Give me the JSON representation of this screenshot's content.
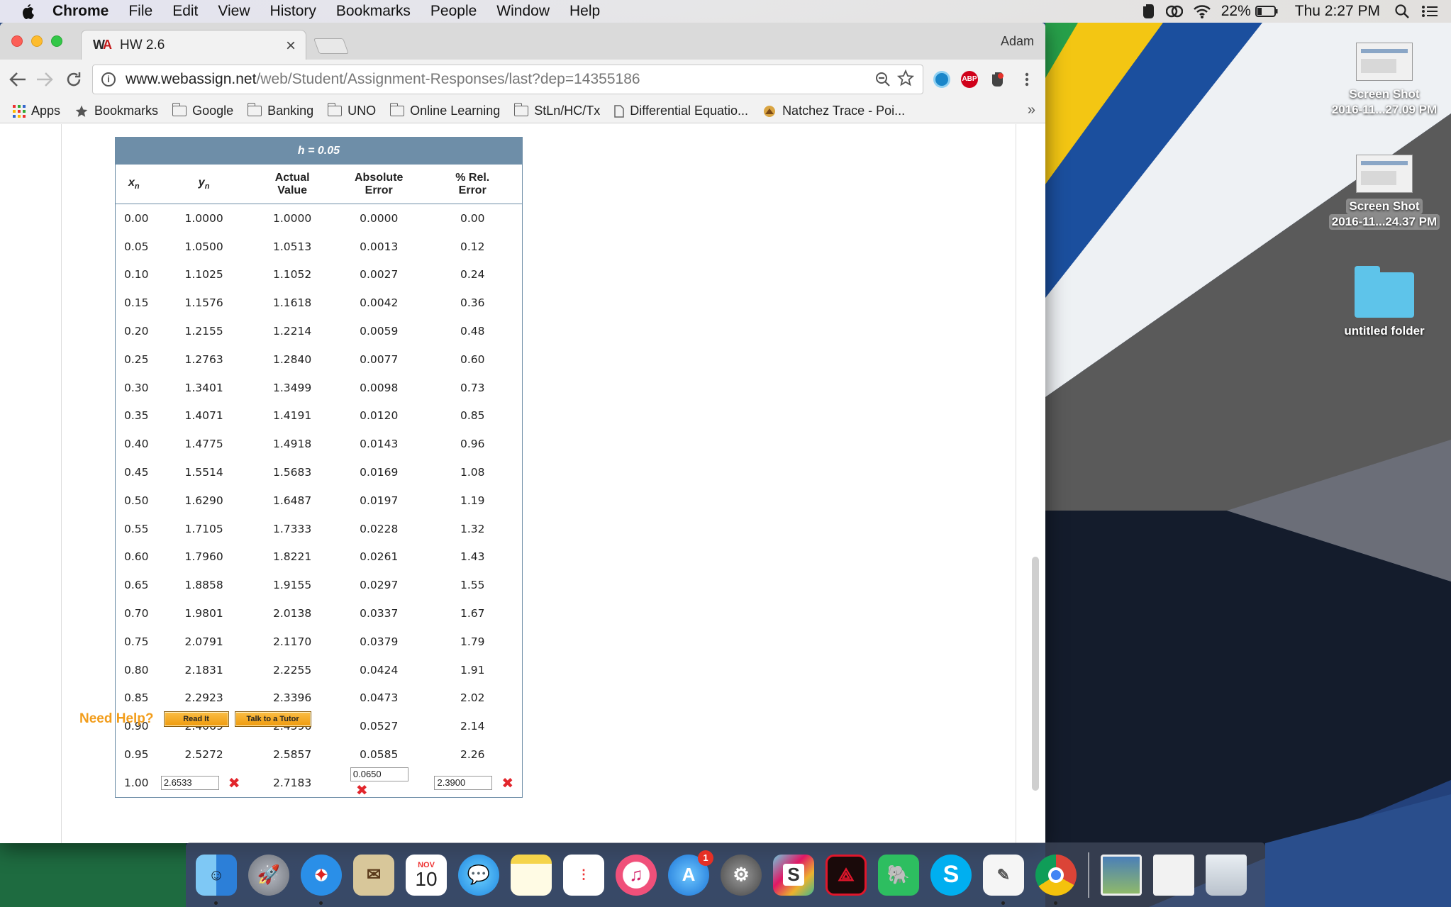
{
  "menubar": {
    "app": "Chrome",
    "items": [
      "File",
      "Edit",
      "View",
      "History",
      "Bookmarks",
      "People",
      "Window",
      "Help"
    ],
    "battery": "22%",
    "clock": "Thu 2:27 PM"
  },
  "browser": {
    "tab_title": "HW 2.6",
    "tab_close": "×",
    "profile": "Adam",
    "url_host": "www.webassign.net",
    "url_path": "/web/Student/Assignment-Responses/last?dep=14355186",
    "bookmarks": [
      "Apps",
      "Bookmarks",
      "Google",
      "Banking",
      "UNO",
      "Online Learning",
      "StLn/HC/Tx",
      "Differential Equatio...",
      "Natchez Trace - Poi..."
    ],
    "more": "»"
  },
  "table": {
    "title": "h = 0.05",
    "headers": [
      "xn",
      "yn",
      "Actual Value",
      "Absolute Error",
      "% Rel. Error"
    ],
    "header_lines": {
      "x": "x",
      "x_sub": "n",
      "y": "y",
      "y_sub": "n",
      "actual_1": "Actual",
      "actual_2": "Value",
      "abs_1": "Absolute",
      "abs_2": "Error",
      "rel_1": "% Rel.",
      "rel_2": "Error"
    },
    "rows": [
      [
        "0.00",
        "1.0000",
        "1.0000",
        "0.0000",
        "0.00"
      ],
      [
        "0.05",
        "1.0500",
        "1.0513",
        "0.0013",
        "0.12"
      ],
      [
        "0.10",
        "1.1025",
        "1.1052",
        "0.0027",
        "0.24"
      ],
      [
        "0.15",
        "1.1576",
        "1.1618",
        "0.0042",
        "0.36"
      ],
      [
        "0.20",
        "1.2155",
        "1.2214",
        "0.0059",
        "0.48"
      ],
      [
        "0.25",
        "1.2763",
        "1.2840",
        "0.0077",
        "0.60"
      ],
      [
        "0.30",
        "1.3401",
        "1.3499",
        "0.0098",
        "0.73"
      ],
      [
        "0.35",
        "1.4071",
        "1.4191",
        "0.0120",
        "0.85"
      ],
      [
        "0.40",
        "1.4775",
        "1.4918",
        "0.0143",
        "0.96"
      ],
      [
        "0.45",
        "1.5514",
        "1.5683",
        "0.0169",
        "1.08"
      ],
      [
        "0.50",
        "1.6290",
        "1.6487",
        "0.0197",
        "1.19"
      ],
      [
        "0.55",
        "1.7105",
        "1.7333",
        "0.0228",
        "1.32"
      ],
      [
        "0.60",
        "1.7960",
        "1.8221",
        "0.0261",
        "1.43"
      ],
      [
        "0.65",
        "1.8858",
        "1.9155",
        "0.0297",
        "1.55"
      ],
      [
        "0.70",
        "1.9801",
        "2.0138",
        "0.0337",
        "1.67"
      ],
      [
        "0.75",
        "2.0791",
        "2.1170",
        "0.0379",
        "1.79"
      ],
      [
        "0.80",
        "2.1831",
        "2.2255",
        "0.0424",
        "1.91"
      ],
      [
        "0.85",
        "2.2923",
        "2.3396",
        "0.0473",
        "2.02"
      ],
      [
        "0.90",
        "2.4069",
        "2.4596",
        "0.0527",
        "2.14"
      ],
      [
        "0.95",
        "2.5272",
        "2.5857",
        "0.0585",
        "2.26"
      ]
    ],
    "last_row": {
      "x": "1.00",
      "y_input": "2.6533",
      "actual": "2.7183",
      "abs_input": "0.0650",
      "rel_input": "2.3900",
      "mark": "✖"
    }
  },
  "help": {
    "label": "Need Help?",
    "read_it": "Read It",
    "tutor": "Talk to a Tutor"
  },
  "desktop": {
    "icons": [
      {
        "line1": "Screen Shot",
        "line2": "2016-11...27.09 PM"
      },
      {
        "line1": "Screen Shot",
        "line2": "2016-11...24.37 PM"
      },
      {
        "line1": "untitled folder"
      }
    ]
  },
  "dock": {
    "calendar_month": "NOV",
    "calendar_day": "10",
    "appstore_badge": "1",
    "icons": [
      "finder-icon",
      "launchpad-icon",
      "safari-icon",
      "mail-icon",
      "calendar-icon",
      "messages-icon",
      "notes-icon",
      "reminders-icon",
      "itunes-icon",
      "app-store-icon",
      "system-preferences-icon",
      "slack-icon",
      "acrobat-icon",
      "evernote-icon",
      "skype-icon",
      "textedit-icon",
      "chrome-icon",
      "photos-folder-icon",
      "documents-icon",
      "trash-icon"
    ]
  }
}
